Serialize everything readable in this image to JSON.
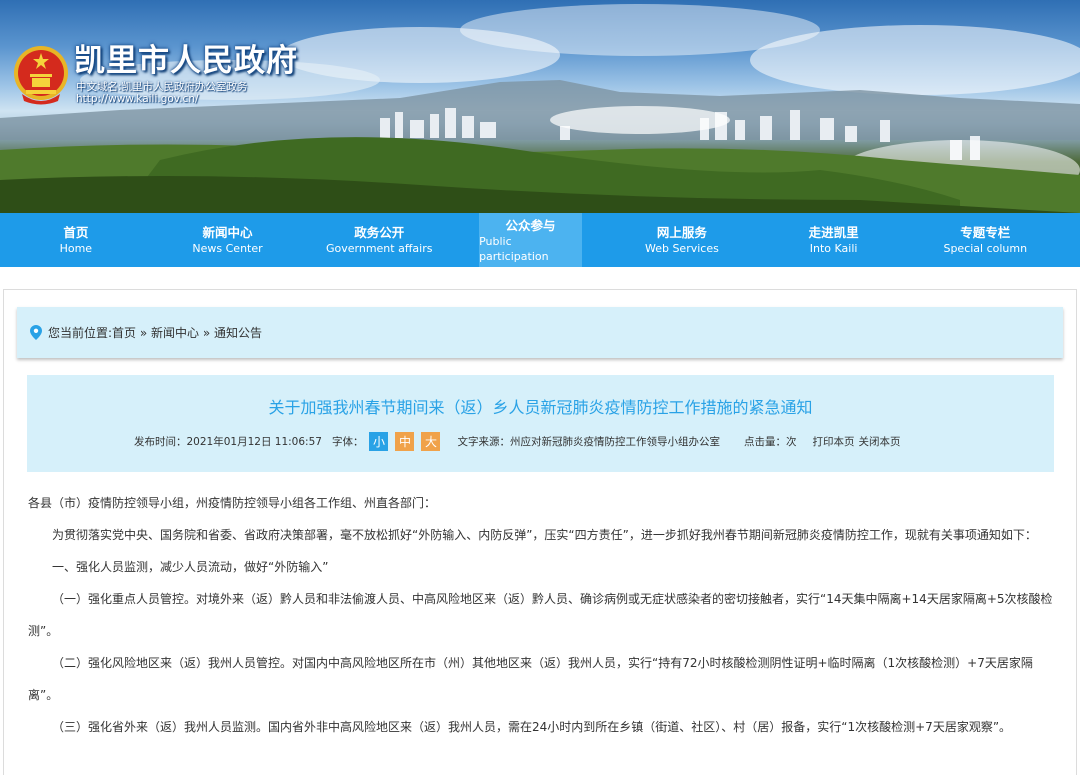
{
  "header": {
    "site_title": "凯里市人民政府",
    "subtitle": "中文域名:凯里市人民政府办公室政务",
    "url": "http://www.kaili.gov.cn/"
  },
  "nav": [
    {
      "cn": "首页",
      "en": "Home"
    },
    {
      "cn": "新闻中心",
      "en": "News Center"
    },
    {
      "cn": "政务公开",
      "en": "Government affairs"
    },
    {
      "cn": "公众参与",
      "en": "Public participation"
    },
    {
      "cn": "网上服务",
      "en": "Web Services"
    },
    {
      "cn": "走进凯里",
      "en": "Into Kaili"
    },
    {
      "cn": "专题专栏",
      "en": "Special column"
    }
  ],
  "breadcrumb": {
    "text": "您当前位置:首页 » 新闻中心 » 通知公告"
  },
  "article": {
    "title": "关于加强我州春节期间来（返）乡人员新冠肺炎疫情防控工作措施的紧急通知",
    "publish_label": "发布时间：",
    "publish_time": "2021年01月12日 11:06:57",
    "font_label": "字体：",
    "font_small": "小",
    "font_medium": "中",
    "font_large": "大",
    "source_label": "文字来源：",
    "source": "州应对新冠肺炎疫情防控工作领导小组办公室",
    "clicks_label": "点击量：",
    "clicks_unit": "次",
    "print_link": "打印本页",
    "close_link": "关闭本页",
    "paragraphs": [
      "各县（市）疫情防控领导小组，州疫情防控领导小组各工作组、州直各部门：",
      "为贯彻落实党中央、国务院和省委、省政府决策部署，毫不放松抓好“外防输入、内防反弹”，压实“四方责任”，进一步抓好我州春节期间新冠肺炎疫情防控工作，现就有关事项通知如下：",
      "一、强化人员监测，减少人员流动，做好“外防输入”",
      "（一）强化重点人员管控。对境外来（返）黔人员和非法偷渡人员、中高风险地区来（返）黔人员、确诊病例或无症状感染者的密切接触者，实行“14天集中隔离+14天居家隔离+5次核酸检测”。",
      "（二）强化风险地区来（返）我州人员管控。对国内中高风险地区所在市（州）其他地区来（返）我州人员，实行“持有72小时核酸检测阴性证明+临时隔离（1次核酸检测）+7天居家隔离”。",
      "（三）强化省外来（返）我州人员监测。国内省外非中高风险地区来（返）我州人员，需在24小时内到所在乡镇（街道、社区）、村（居）报备，实行“1次核酸检测+7天居家观察”。"
    ]
  },
  "colors": {
    "nav_bg": "#1e9be9",
    "nav_active": "#4cb3f0",
    "title_blue": "#29a2e6",
    "panel_bg": "#d6f0fa",
    "font_btn_orange": "#f0a24a"
  }
}
